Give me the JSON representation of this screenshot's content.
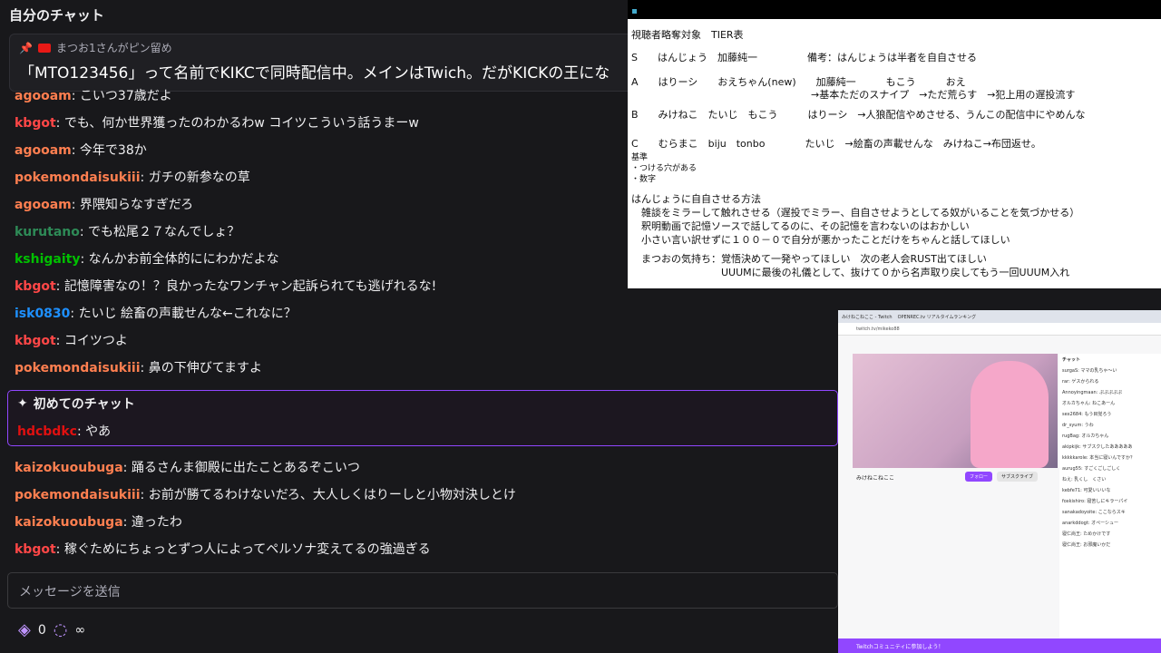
{
  "chat": {
    "title": "自分のチャット",
    "pinned": {
      "by": "まつお1さんがピン留め",
      "text": "「MTO123456」って名前でKIKCで同時配信中。メインはTwich。だがKICKの王にな"
    },
    "messages": [
      {
        "user": "agooam",
        "color": "#ff7f50",
        "text": ": こいつ37歳だよ"
      },
      {
        "user": "kbgot",
        "color": "#ff4747",
        "text": ": でも、何か世界獲ったのわかるわw コイツこういう話うまーw"
      },
      {
        "user": "agooam",
        "color": "#ff7f50",
        "text": ": 今年で38か"
      },
      {
        "user": "pokemondaisukiii",
        "color": "#ff7f50",
        "text": ": ガチの新参なの草"
      },
      {
        "user": "agooam",
        "color": "#ff7f50",
        "text": ": 界隈知らなすぎだろ"
      },
      {
        "user": "kurutano",
        "color": "#2e8b57",
        "text": ": でも松尾２７なんでしょ？"
      },
      {
        "user": "kshigaity",
        "color": "#00c000",
        "text": ": なんかお前全体的ににわかだよな"
      },
      {
        "user": "kbgot",
        "color": "#ff4747",
        "text": ": 記憶障害なの！？良かったなワンチャン起訴られても逃げれるな!"
      },
      {
        "user": "isk0830",
        "color": "#1e90ff",
        "text": ": たいじ 絵畜の声載せんな←これなに？"
      },
      {
        "user": "kbgot",
        "color": "#ff4747",
        "text": ": コイツつよ"
      },
      {
        "user": "pokemondaisukiii",
        "color": "#ff7f50",
        "text": ": 鼻の下伸びてますよ"
      }
    ],
    "first_chat": {
      "label": "初めてのチャット",
      "user": "hdcbdkc",
      "color": "#e01010",
      "text": ": やあ"
    },
    "messages2": [
      {
        "user": "kaizokuoubuga",
        "color": "#ff7f50",
        "text": ": 踊るさんま御殿に出たことあるぞこいつ"
      },
      {
        "user": "pokemondaisukiii",
        "color": "#ff7f50",
        "text": ": お前が勝てるわけないだろ、大人しくはりーしと小物対決しとけ"
      },
      {
        "user": "kaizokuoubuga",
        "color": "#ff7f50",
        "text": ": 違ったわ"
      },
      {
        "user": "kbgot",
        "color": "#ff4747",
        "text": ": 稼ぐためにちょっとずつ人によってペルソナ変えてるの強過ぎる"
      }
    ],
    "input_placeholder": "メッセージを送信",
    "points": "0",
    "infinity": "∞"
  },
  "tier": {
    "lines": [
      "視聴者略奪対象　TIER表",
      "S　　はんじょう　加藤純一　　　　　備考：はんじょうは半者を自自させる",
      "A　　はりーシ　　おえちゃん(new)　　加藤純一　　　もこう　　　おえ",
      "　　　　　　　　　　　　　　　　　　→基本ただのスナイプ　→ただ荒らす　→犯上用の遅投流す",
      "B　　みけねこ　たいじ　もこう　　　はりーシ　→人狼配信やめさせる、うんこの配信中にやめんな",
      "C　　むらまこ　biju　tonbo　　　　たいじ　→絵畜の声載せんな　みけねこ→布団返せ。",
      "基準",
      "・つける穴がある",
      "・数字",
      "はんじょうに自自させる方法",
      "　雑談をミラーして触れさせる（遅投でミラー、自自させようとしてる奴がいることを気づかせる）",
      "　釈明動画で記憶ソースで話してるのに、その記憶を言わないのはおかしい",
      "　小さい言い訳せずに１００－０で自分が悪かったことだけをちゃんと話してほしい",
      "　まつおの気持ち：覚悟決めて一発やってほしい　次の老人会RUST出てほしい",
      "　　　　　　　　　UUUMに最後の礼儀として、抜けて０から名声取り戻してもう一回UUUM入れ"
    ]
  },
  "browser": {
    "tab1": "みけねこねここ - Twitch",
    "tab2": "OPENREC.tv リアルタイムランキング",
    "url": "twitch.tv/mikeko88",
    "streamer": "みけねこねここ",
    "chat_label": "チャット",
    "follow": "フォロー",
    "subscribe": "サブスクライブ",
    "chat_lines": [
      "surgaS: ママの乳ちゃ〜い",
      "rar: ゲスかられる",
      "Annoyingmaan: ぷぷぷぷぷ",
      "オルカちゃん: ねこあーん",
      "sex2684: もう目覚ろう",
      "dr_syum: うわ",
      "rugBag: オルカちゃん",
      "akipkijk: サブスクしたあああああ",
      "kkkkkarole: 本当に寝いんですか？",
      "aurug55: すごくごしごしく",
      "ねえ: 乳くし　くさい",
      "kebfe71: 可愛いいいな",
      "foxkishiro: 寝苦しにキラーパイ",
      "sanakadoyoite: ここならスキ",
      "anarkddogt: オペーシュー",
      "寝仁尚王: ためかけです",
      "寝仁尚王: お邪魔いかだ"
    ],
    "bottom_banner": "Twitchコミュニティに参加しよう！"
  }
}
